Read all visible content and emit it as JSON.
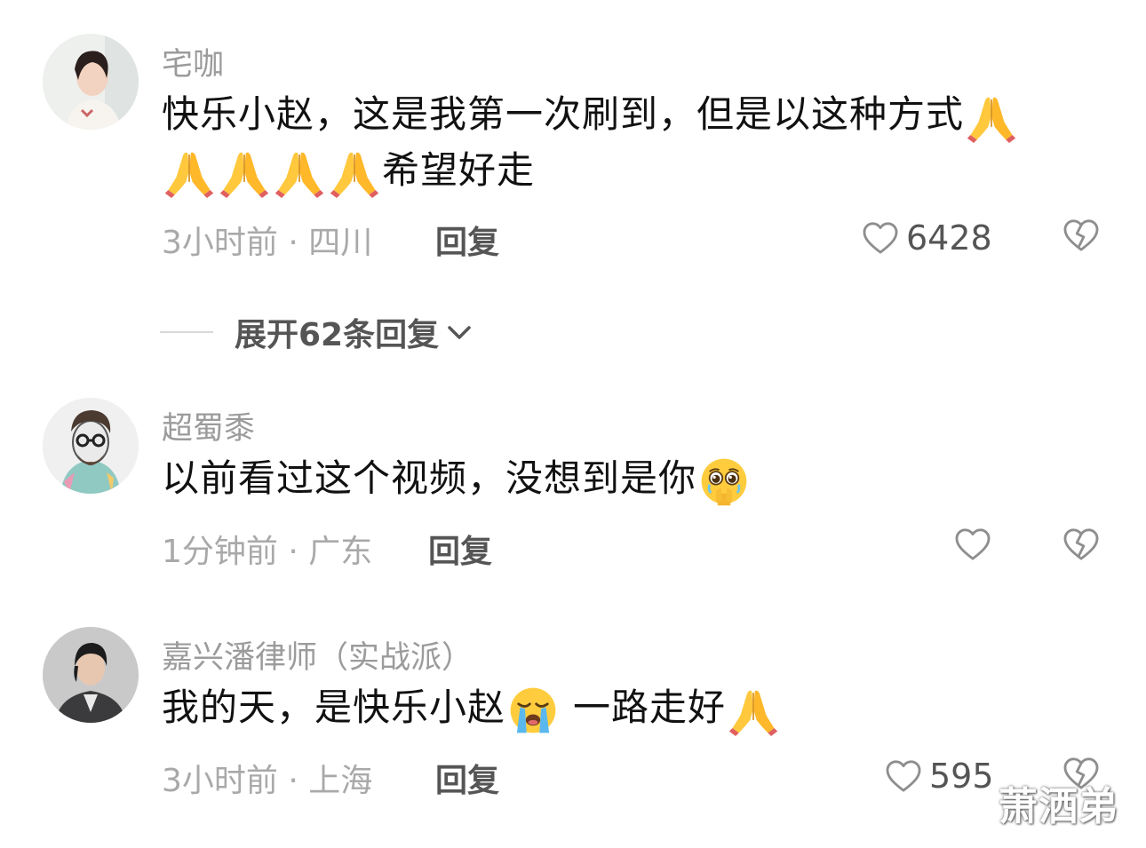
{
  "comments": [
    {
      "username": "宅咖",
      "text_part1": "快乐小赵，这是我第一次刷到，但是以这种方式",
      "text_part2": "希望好走",
      "meta": "3小时前 · 四川",
      "reply_label": "回复",
      "like_count": "6428",
      "emojis": [
        "pray-emoji",
        "pray-emoji",
        "pray-emoji",
        "pray-emoji",
        "pray-emoji"
      ]
    },
    {
      "username": "超蜀黍",
      "text": "以前看过这个视频，没想到是你",
      "meta": "1分钟前 · 广东",
      "reply_label": "回复",
      "like_count": "",
      "emojis": [
        "pleading-face-emoji"
      ]
    },
    {
      "username": "嘉兴潘律师（实战派）",
      "text_part1": "我的天，是快乐小赵",
      "text_part2": "一路走好",
      "meta": "3小时前 · 上海",
      "reply_label": "回复",
      "like_count": "595",
      "emojis": [
        "loudly-crying-emoji",
        "pray-emoji"
      ]
    }
  ],
  "expand_replies": {
    "label": "展开62条回复"
  },
  "watermark": "萧洒弟",
  "colors": {
    "username": "#9b9b9b",
    "text": "#111111",
    "meta": "#a9a9a9",
    "action": "#555555",
    "icon_stroke": "#8e8e8e"
  }
}
